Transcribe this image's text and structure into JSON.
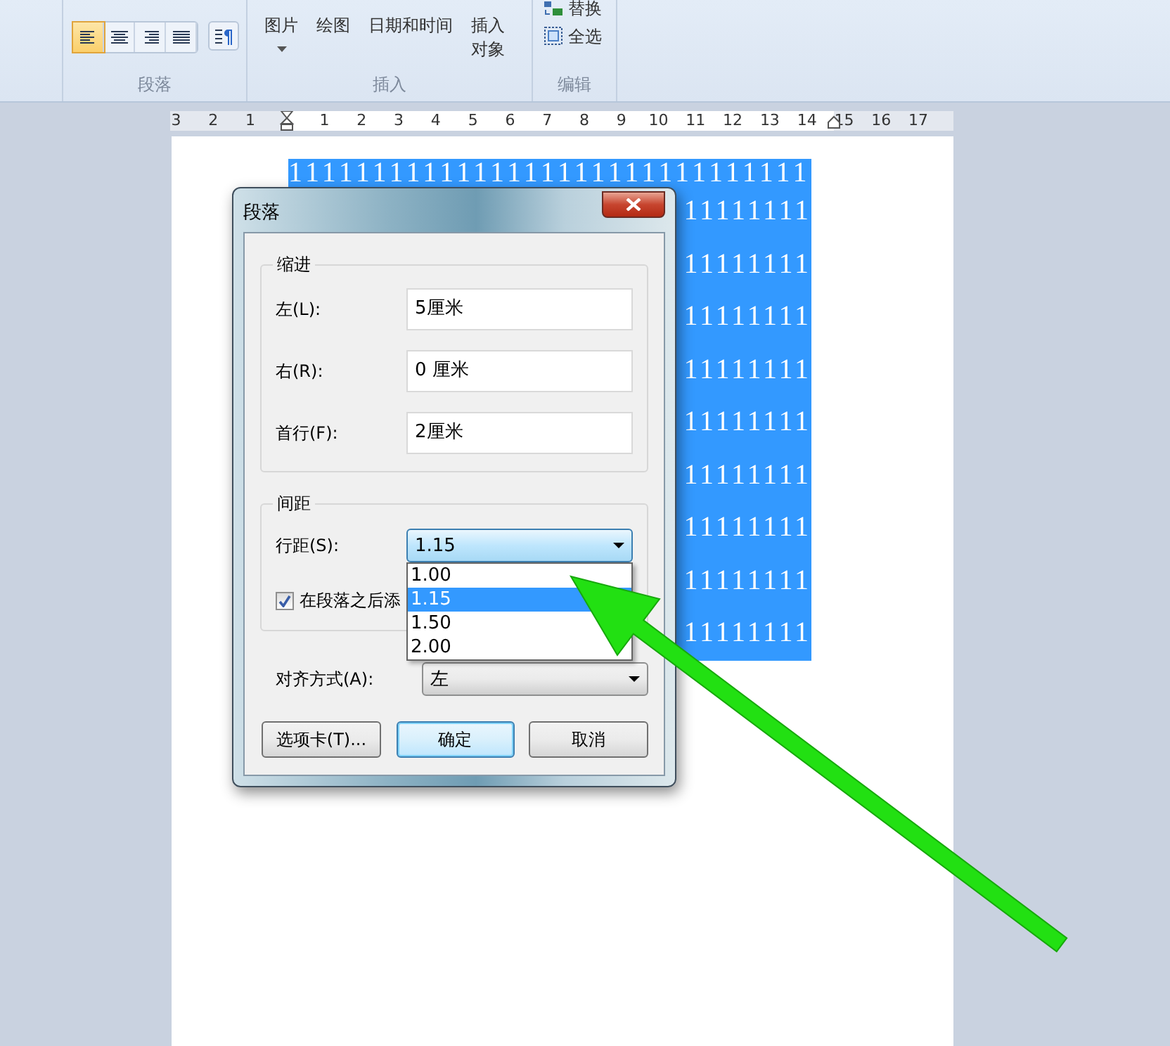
{
  "ribbon": {
    "paragraph_group": {
      "label": "段落",
      "alignment_buttons": [
        {
          "kind": "left",
          "selected": true
        },
        {
          "kind": "center",
          "selected": false
        },
        {
          "kind": "right",
          "selected": false
        },
        {
          "kind": "justify",
          "selected": false
        }
      ]
    },
    "insert_group": {
      "label": "插入",
      "items": [
        {
          "lines": [
            "图片"
          ],
          "dropdown": true
        },
        {
          "lines": [
            "绘图"
          ],
          "dropdown": false
        },
        {
          "lines": [
            "日期和时间"
          ],
          "dropdown": false
        },
        {
          "lines": [
            "插入",
            "对象"
          ],
          "dropdown": false
        }
      ]
    },
    "edit_group": {
      "label": "编辑",
      "items": [
        {
          "kind": "replace",
          "label": "替换"
        },
        {
          "kind": "select_all",
          "label": "全选"
        }
      ]
    }
  },
  "ruler": {
    "left_numbers": [
      "3",
      "2",
      "1"
    ],
    "right_numbers": [
      "1",
      "2",
      "3",
      "4",
      "5",
      "6",
      "7",
      "8",
      "9",
      "10",
      "11",
      "12",
      "13",
      "14",
      "15",
      "16",
      "17"
    ]
  },
  "document": {
    "selected_lines": [
      "1111111111111111111111111111111",
      "11111111",
      "11111111",
      "11111111",
      "11111111",
      "11111111",
      "11111111",
      "11111111",
      "11111111",
      "11111111"
    ]
  },
  "dialog": {
    "title": "段落",
    "indent": {
      "legend": "缩进",
      "fields": [
        {
          "label": "左(L):",
          "value": "5厘米"
        },
        {
          "label": "右(R):",
          "value": "0 厘米"
        },
        {
          "label": "首行(F):",
          "value": "2厘米"
        }
      ]
    },
    "spacing": {
      "legend": "间距",
      "line_spacing": {
        "label": "行距(S):",
        "value": "1.15",
        "expanded": true,
        "options": [
          {
            "label": "1.00",
            "selected": false
          },
          {
            "label": "1.15",
            "selected": true
          },
          {
            "label": "1.50",
            "selected": false
          },
          {
            "label": "2.00",
            "selected": false
          }
        ]
      },
      "after_paragraph": {
        "label": "在段落之后添",
        "checked": true
      }
    },
    "alignment": {
      "label": "对齐方式(A):",
      "value": "左"
    },
    "buttons": [
      {
        "label": "选项卡(T)...",
        "focused": false
      },
      {
        "label": "确定",
        "focused": true
      },
      {
        "label": "取消",
        "focused": false
      }
    ]
  }
}
